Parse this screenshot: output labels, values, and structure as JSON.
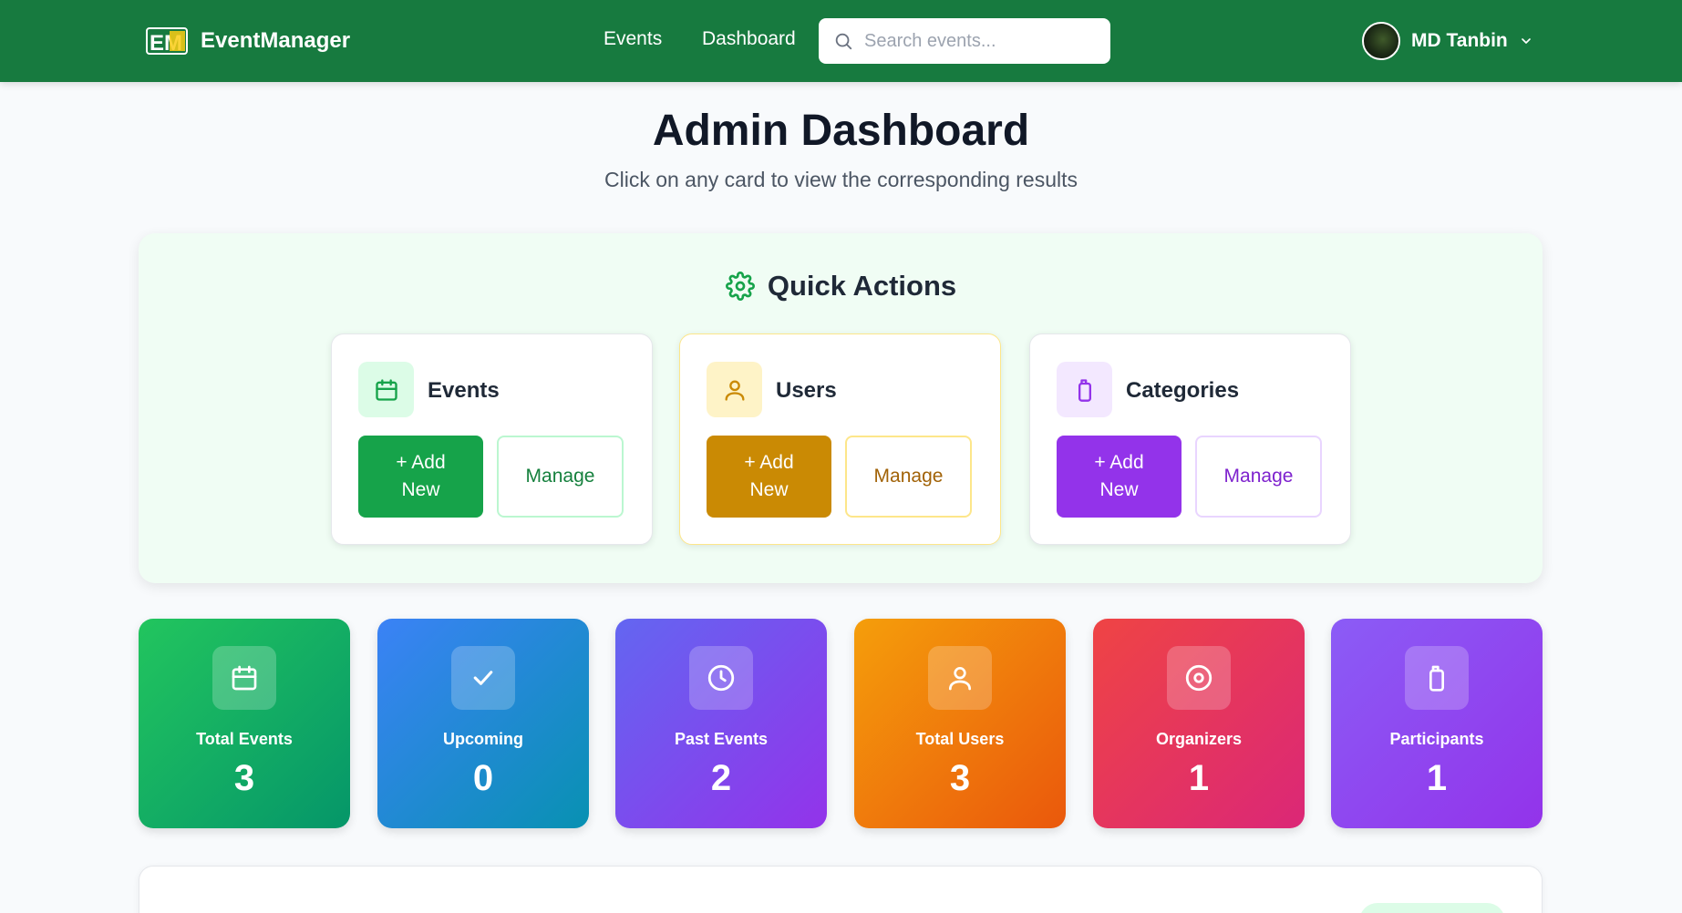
{
  "navbar": {
    "brand_logo_text": "EM",
    "brand_name": "EventManager",
    "links": [
      "Events",
      "Dashboard"
    ],
    "search_placeholder": "Search events...",
    "user_name": "MD Tanbin",
    "background_color": "#177a3f"
  },
  "page": {
    "title": "Admin Dashboard",
    "subtitle": "Click on any card to view the corresponding results"
  },
  "quick_actions": {
    "title": "Quick Actions",
    "icon": "gear-icon",
    "cards": [
      {
        "title": "Events",
        "icon": "calendar-icon",
        "add_label_line1": "+ Add",
        "add_label_line2": "New",
        "manage_label": "Manage",
        "accent": "#16a34a"
      },
      {
        "title": "Users",
        "icon": "users-icon",
        "add_label_line1": "+ Add",
        "add_label_line2": "New",
        "manage_label": "Manage",
        "accent": "#ca8a04"
      },
      {
        "title": "Categories",
        "icon": "tag-icon",
        "add_label_line1": "+ Add",
        "add_label_line2": "New",
        "manage_label": "Manage",
        "accent": "#9333ea"
      }
    ]
  },
  "stats": [
    {
      "label": "Total Events",
      "value": "3",
      "icon": "calendar-icon"
    },
    {
      "label": "Upcoming",
      "value": "0",
      "icon": "check-icon"
    },
    {
      "label": "Past Events",
      "value": "2",
      "icon": "clock-icon"
    },
    {
      "label": "Total Users",
      "value": "3",
      "icon": "users-icon"
    },
    {
      "label": "Organizers",
      "value": "1",
      "icon": "target-icon"
    },
    {
      "label": "Participants",
      "value": "1",
      "icon": "tag-icon"
    }
  ]
}
